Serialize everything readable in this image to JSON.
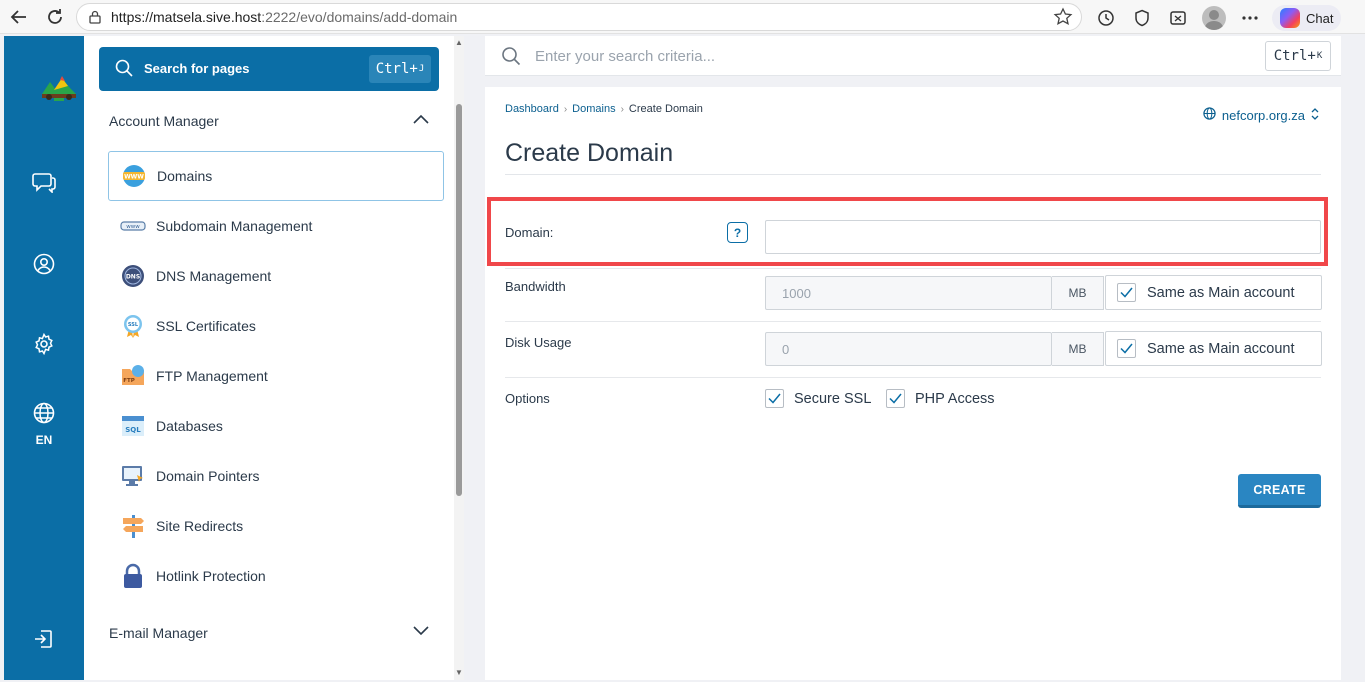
{
  "browser": {
    "url_host": "https://matsela.sive.host",
    "url_rest": ":2222/evo/domains/add-domain",
    "chat_label": "Chat"
  },
  "rail": {
    "language_label": "EN"
  },
  "sidebar": {
    "search_label": "Search for pages",
    "search_shortcut": "Ctrl+",
    "search_shortcut_key": "J",
    "account_section": "Account Manager",
    "email_section": "E-mail Manager",
    "items": [
      {
        "label": "Domains"
      },
      {
        "label": "Subdomain Management"
      },
      {
        "label": "DNS Management"
      },
      {
        "label": "SSL Certificates"
      },
      {
        "label": "FTP Management"
      },
      {
        "label": "Databases"
      },
      {
        "label": "Domain Pointers"
      },
      {
        "label": "Site Redirects"
      },
      {
        "label": "Hotlink Protection"
      }
    ]
  },
  "topsearch": {
    "placeholder": "Enter your search criteria...",
    "shortcut": "Ctrl+",
    "shortcut_key": "K"
  },
  "breadcrumb": [
    "Dashboard",
    "Domains",
    "Create Domain"
  ],
  "domain_selector": "nefcorp.org.za",
  "page_title": "Create Domain",
  "form": {
    "domain_label": "Domain:",
    "domain_value": "",
    "help_label": "?",
    "bandwidth_label": "Bandwidth",
    "bandwidth_value": "1000",
    "bandwidth_unit": "MB",
    "disk_label": "Disk Usage",
    "disk_value": "0",
    "disk_unit": "MB",
    "same_as_main": "Same as Main account",
    "options_label": "Options",
    "secure_ssl": "Secure SSL",
    "php_access": "PHP Access",
    "create_button": "CREATE"
  },
  "colors": {
    "brand_blue": "#0b6ea6",
    "highlight_red": "#f0474a",
    "button_blue": "#2a86c2"
  }
}
